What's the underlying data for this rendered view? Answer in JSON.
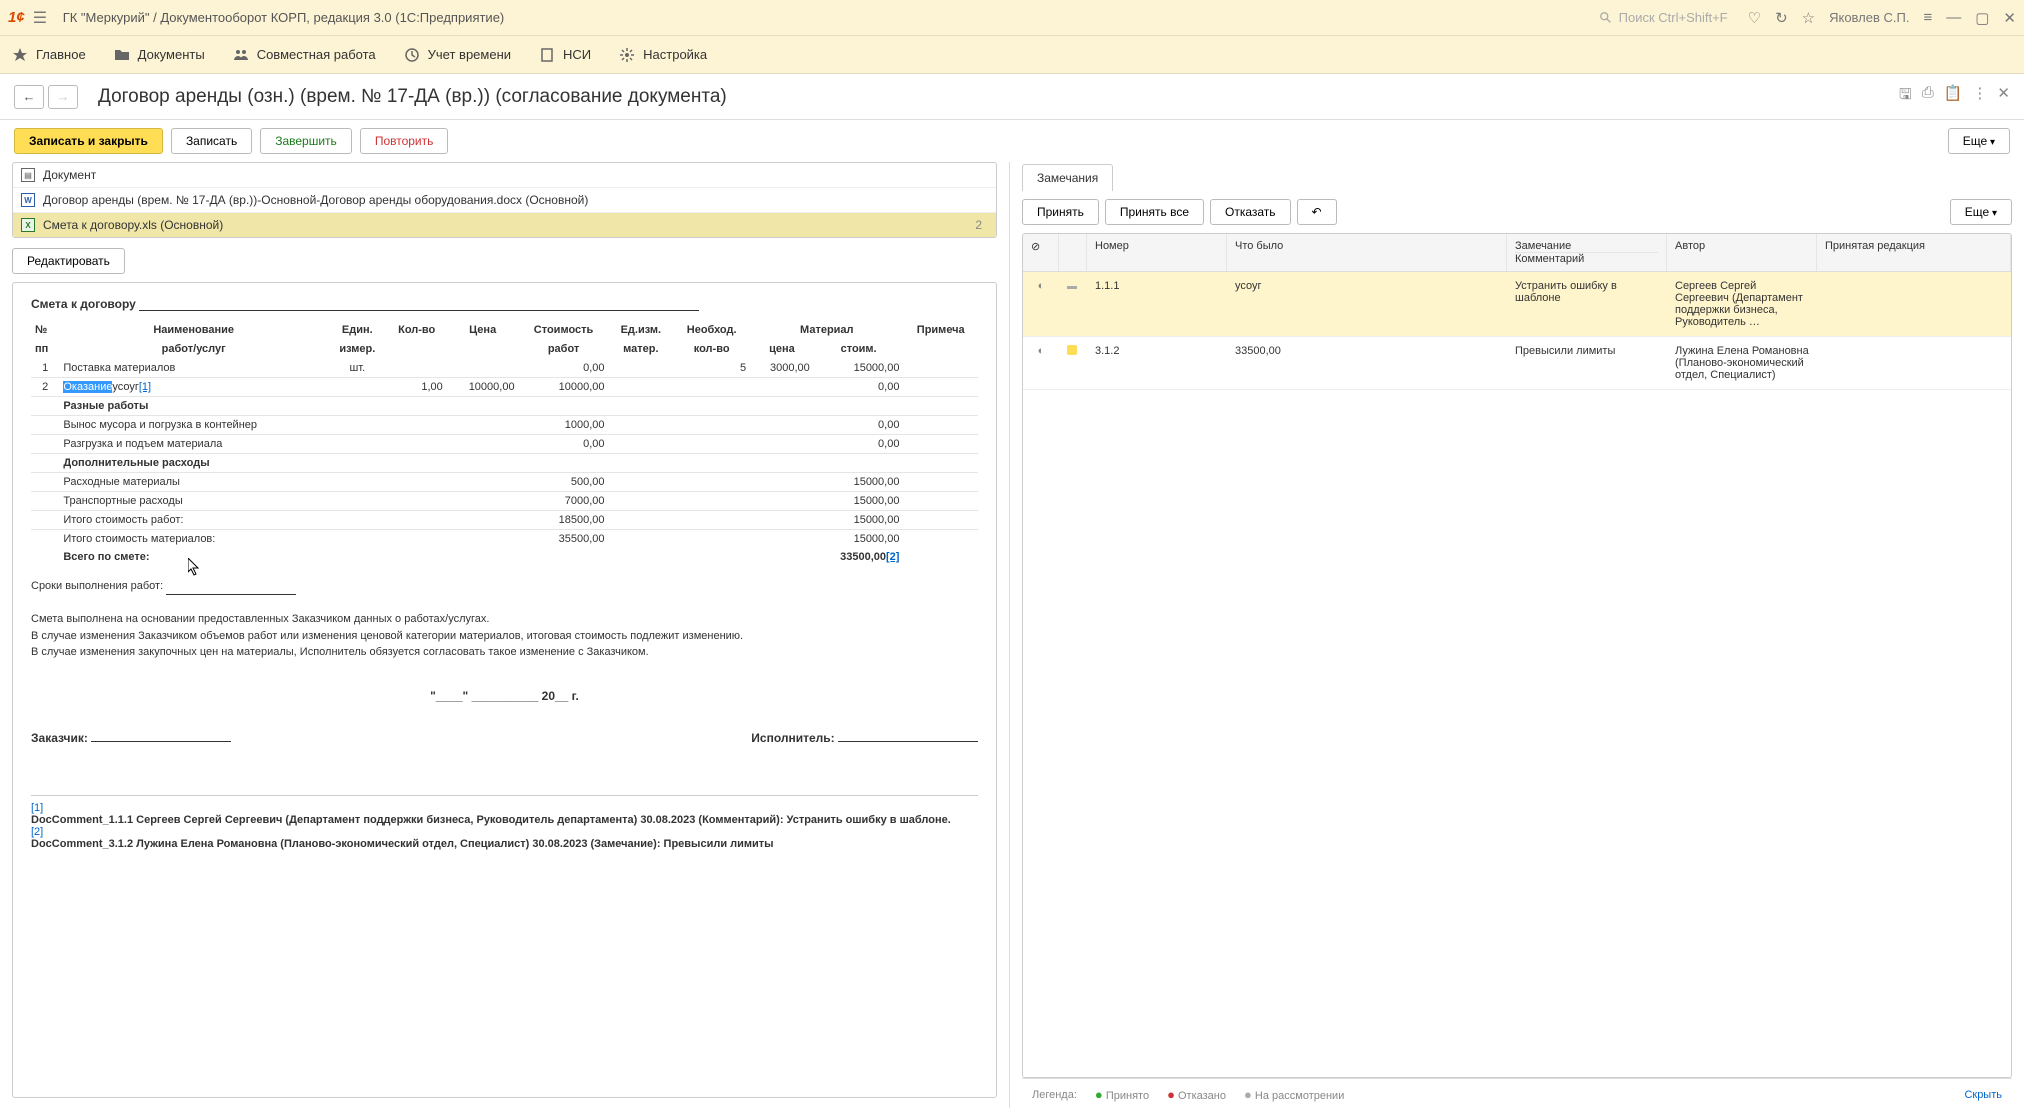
{
  "app": {
    "title": "ГК \"Меркурий\" / Документооборот КОРП, редакция 3.0  (1С:Предприятие)",
    "search_placeholder": "Поиск Ctrl+Shift+F",
    "user": "Яковлев С.П."
  },
  "mainnav": {
    "home": "Главное",
    "documents": "Документы",
    "collab": "Совместная работа",
    "time": "Учет времени",
    "nsi": "НСИ",
    "settings": "Настройка"
  },
  "doc": {
    "title": "Договор аренды (озн.) (врем. № 17-ДА (вр.)) (согласование документа)"
  },
  "actions": {
    "save_close": "Записать и закрыть",
    "save": "Записать",
    "complete": "Завершить",
    "retry": "Повторить",
    "more": "Еще"
  },
  "files": {
    "header": "Документ",
    "row1": "Договор аренды (врем. № 17-ДА (вр.))-Основной-Договор аренды оборудования.docx (Основной)",
    "row2": "Смета к договору.xls (Основной)",
    "row2_badge": "2",
    "edit": "Редактировать"
  },
  "estimate": {
    "title": "Смета к договору",
    "headers": {
      "no1": "№",
      "no2": "пп",
      "name1": "Наименование",
      "name2": "работ/услуг",
      "unit1": "Един.",
      "unit2": "измер.",
      "qty": "Кол-во",
      "price": "Цена",
      "cost1": "Стоимость",
      "cost2": "работ",
      "matunit1": "Ед.изм.",
      "matunit2": "матер.",
      "matqty1": "Необход.",
      "matqty2": "кол-во",
      "matprice1": "Материал",
      "matprice2": "цена",
      "matcost2": "стоим.",
      "note": "Примеча"
    },
    "rows": [
      {
        "n": "1",
        "name": "Поставка материалов",
        "unit": "шт.",
        "qty": "",
        "price": "",
        "cost": "0,00",
        "mq": "5",
        "mp": "3000,00",
        "mc": "15000,00"
      },
      {
        "n": "2",
        "name_sel": "Оказание",
        "name_rest": "усоуг",
        "ref": "[1]",
        "unit": "",
        "qty": "1,00",
        "price": "10000,00",
        "cost": "10000,00",
        "mq": "",
        "mp": "",
        "mc": "0,00"
      },
      {
        "section": "Разные работы"
      },
      {
        "name": "Вынос мусора и погрузка в контейнер",
        "cost": "1000,00",
        "mc": "0,00"
      },
      {
        "name": "Разгрузка и подъем материала",
        "cost": "0,00",
        "mc": "0,00"
      },
      {
        "section": "Дополнительные расходы"
      },
      {
        "name": "Расходные материалы",
        "cost": "500,00",
        "mc": "15000,00"
      },
      {
        "name": "Транспортные расходы",
        "cost": "7000,00",
        "mc": "15000,00"
      },
      {
        "name": "Итого стоимость работ:",
        "cost": "18500,00",
        "mc": "15000,00"
      },
      {
        "name": "Итого стоимость материалов:",
        "cost": "35500,00",
        "mc": "15000,00"
      }
    ],
    "total_label": "Всего по смете:",
    "total_value": "33500,00",
    "total_ref": "[2]",
    "terms_label": "Сроки выполнения работ:",
    "note1": "Смета выполнена на основании предоставленных Заказчиком данных о работах/услугах.",
    "note2": "В случае изменения Заказчиком объемов работ или изменения ценовой категории материалов, итоговая стоимость подлежит изменению.",
    "note3": "В случае изменения закупочных цен на материалы, Исполнитель обязуется согласовать такое изменение с Заказчиком.",
    "date_tpl": "\"____\" __________ 20__ г.",
    "customer": "Заказчик:",
    "contractor": "Исполнитель:",
    "fn1_ref": "[1]",
    "fn1": "DocComment_1.1.1 Сергеев Сергей Сергеевич (Департамент поддержки бизнеса, Руководитель департамента) 30.08.2023 (Комментарий): Устранить ошибку в шаблоне.",
    "fn2_ref": "[2]",
    "fn2": "DocComment_3.1.2 Лужина Елена Романовна (Планово-экономический отдел, Специалист) 30.08.2023 (Замечание): Превысили лимиты"
  },
  "remarks": {
    "tab": "Замечания",
    "accept": "Принять",
    "accept_all": "Принять все",
    "reject": "Отказать",
    "undo": "↶",
    "more": "Еще",
    "cols": {
      "num": "Номер",
      "what": "Что было",
      "remark": "Замечание",
      "author": "Автор",
      "redaction": "Принятая редакция",
      "comment": "Комментарий"
    },
    "rows": [
      {
        "num": "1.1.1",
        "what": "усоуг",
        "comment": "Устранить ошибку в шаблоне",
        "author": "Сергеев Сергей Сергеевич (Департамент поддержки бизнеса, Руководитель …",
        "selected": true,
        "marker": "gray"
      },
      {
        "num": "3.1.2",
        "what": "33500,00",
        "remark": "Превысили лимиты",
        "author": "Лужина Елена Романовна (Планово-экономический отдел, Специалист)",
        "marker": "yellow"
      }
    ]
  },
  "legend": {
    "label": "Легенда:",
    "accepted": "Принято",
    "rejected": "Отказано",
    "pending": "На рассмотрении",
    "hide": "Скрыть"
  }
}
